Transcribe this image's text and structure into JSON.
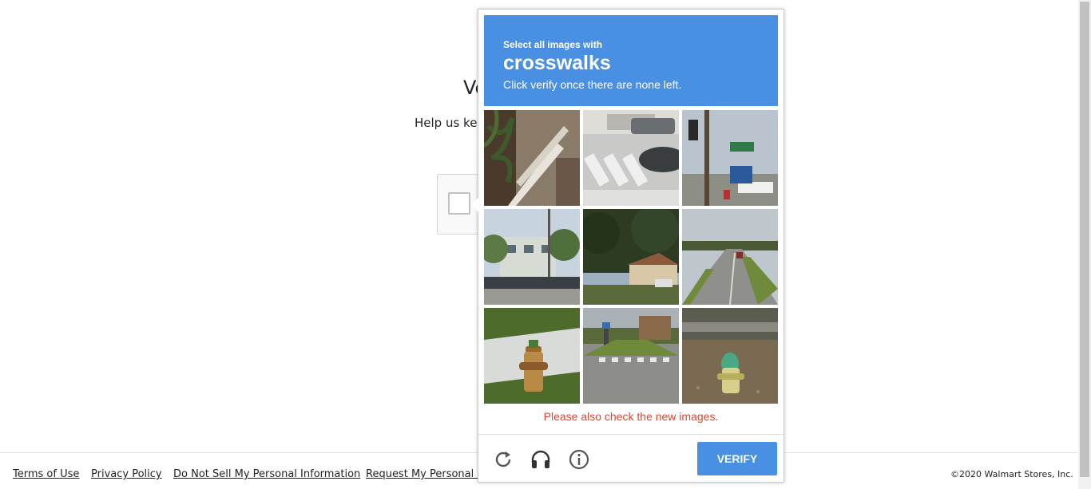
{
  "page": {
    "heading": "Ve",
    "subtext": "Help us kee"
  },
  "footer": {
    "links": [
      "Terms of Use",
      "Privacy Policy",
      "Do Not Sell My Personal Information",
      "Request My Personal In"
    ],
    "copyright": "©2020 Walmart Stores, Inc."
  },
  "captcha": {
    "instruction_small": "Select all images with",
    "keyword": "crosswalks",
    "instruction_hint": "Click verify once there are none left.",
    "error_message": "Please also check the new images.",
    "verify_label": "VERIFY",
    "accent_color": "#4a90e2",
    "error_color": "#d14836",
    "tiles": [
      {
        "subject": "building stairs with palm tree"
      },
      {
        "subject": "street with crosswalk and parked car"
      },
      {
        "subject": "traffic light and street signs"
      },
      {
        "subject": "building with palm trees and parked cars"
      },
      {
        "subject": "house with trees"
      },
      {
        "subject": "road with car"
      },
      {
        "subject": "fire hydrant on grass"
      },
      {
        "subject": "intersection with crosswalk"
      },
      {
        "subject": "green fire hydrant on gravel"
      }
    ],
    "footer_icons": [
      "reload-icon",
      "audio-headphones-icon",
      "info-icon"
    ]
  }
}
